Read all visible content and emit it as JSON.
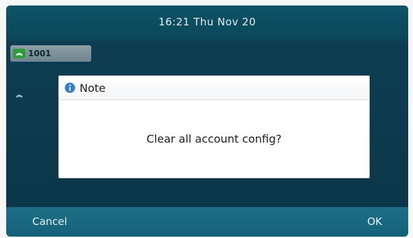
{
  "status_bar": {
    "datetime": "16:21 Thu Nov 20"
  },
  "line_keys": [
    {
      "label": "1001",
      "icon": "phone-icon"
    },
    {
      "label": "",
      "icon": "phone-icon"
    }
  ],
  "dialog": {
    "icon": "info-icon",
    "title": "Note",
    "message": "Clear all account config?"
  },
  "softkeys": {
    "cancel_label": "Cancel",
    "ok_label": "OK"
  },
  "colors": {
    "screen_bg": "#0d3a4e",
    "status_bar": "#0b4659",
    "softkey_bar": "#17657e",
    "line_key_icon": "#2e9a3a",
    "info_icon": "#2f7fd0"
  }
}
